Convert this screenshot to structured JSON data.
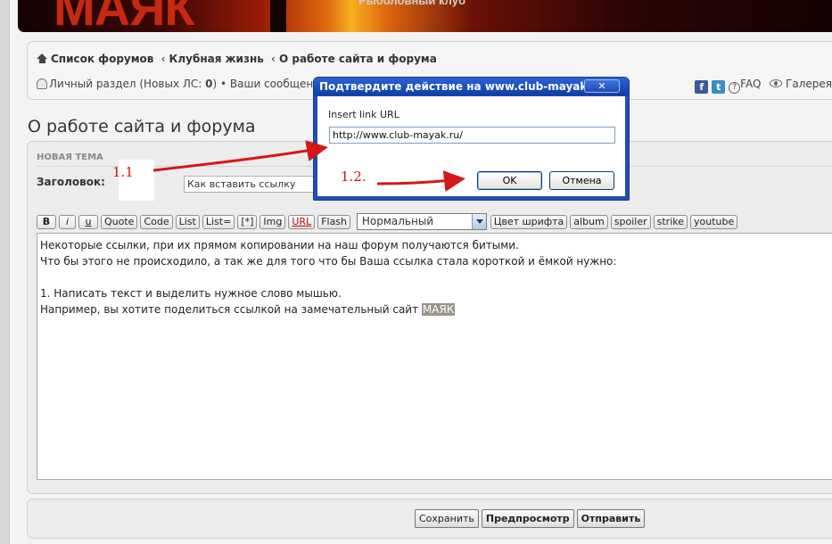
{
  "banner": {
    "logo": "МАЯК",
    "subtitle": "Рыболовный клуб"
  },
  "nav": {
    "breadcrumb": [
      "Список форумов",
      "Клубная жизнь",
      "О работе сайта и форума"
    ],
    "breadcrumb_sep": "‹",
    "user_line_prefix": "Личный раздел (Новых ЛС: ",
    "new_pm_count": "0",
    "user_line_suffix": ") • Ваши сообщения",
    "faq": "FAQ",
    "gallery": "Галерея"
  },
  "page": {
    "title": "О работе сайта и форума"
  },
  "post": {
    "section_header": "НОВАЯ ТЕМА",
    "subject_label": "Заголовок:",
    "subject_value": "Как вставить ссылку",
    "toolbar": [
      "B",
      "i",
      "u",
      "Quote",
      "Code",
      "List",
      "List=",
      "[*]",
      "Img",
      "URL",
      "Flash"
    ],
    "font_size_selected": "Нормальный",
    "toolbar_right": [
      "Цвет шрифта",
      "album",
      "spoiler",
      "strike",
      "youtube"
    ],
    "message_lines": [
      "Некоторые ссылки, при их прямом копировании на наш форум получаются битыми.",
      "Что бы этого не происходило, а так же для того что бы Ваша ссылка стала короткой и ёмкой нужно:",
      "",
      "1. Написать текст и выделить нужное слово мышью.",
      "Например,  вы хотите поделиться ссылкой на замечательный сайт "
    ],
    "selected_word": "МАЯК"
  },
  "actions": {
    "save": "Сохранить",
    "preview": "Предпросмотр",
    "submit": "Отправить"
  },
  "dialog": {
    "title": "Подтвердите действие на www.club-mayak.ru",
    "close": "✕",
    "label": "Insert link URL",
    "value": "http://www.club-mayak.ru/",
    "ok": "OK",
    "cancel": "Отмена"
  },
  "annotations": {
    "step1": "1.1",
    "step2": "1.2."
  },
  "colors": {
    "annotation": "#c81515",
    "dialog_frame": "#1f4fb5"
  }
}
